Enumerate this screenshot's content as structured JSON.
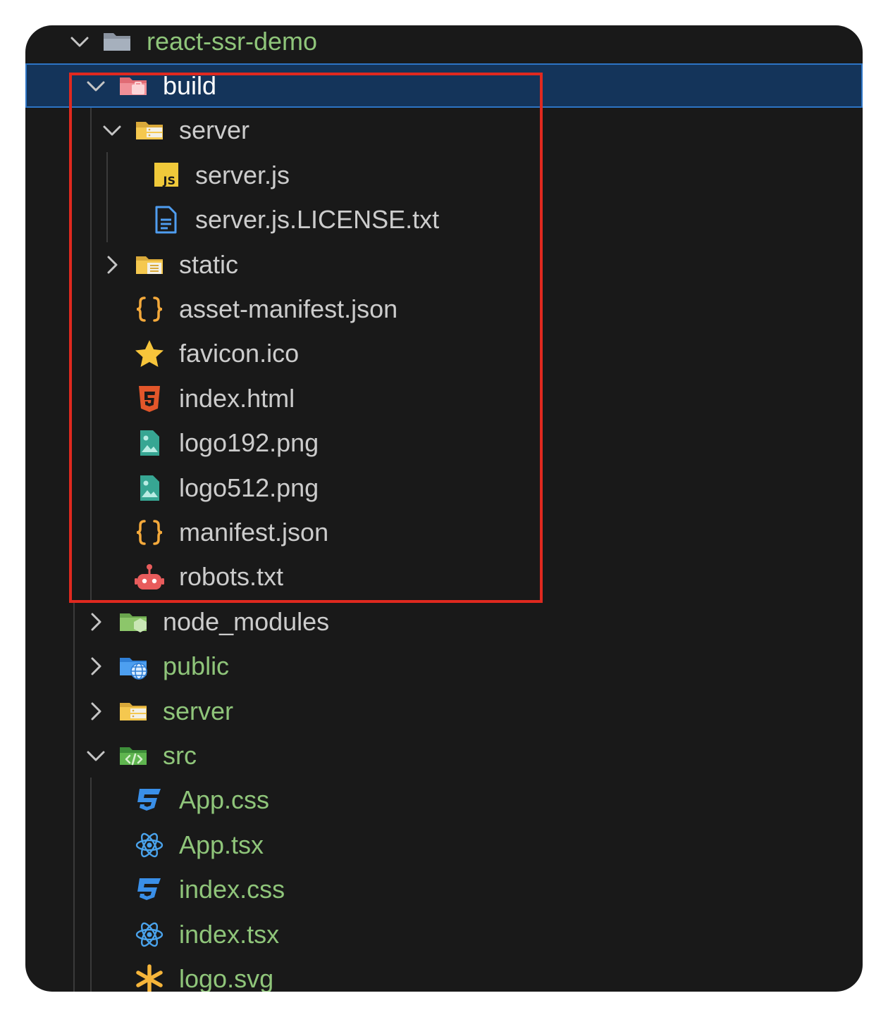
{
  "explorer": {
    "root": {
      "label": "react-ssr-demo",
      "icon": "folder-icon",
      "expanded": true
    },
    "items": [
      {
        "key": "build",
        "label": "build",
        "icon": "build-folder-icon",
        "depth": 1,
        "type": "folder",
        "expanded": true,
        "selected": true
      },
      {
        "key": "build-server",
        "label": "server",
        "icon": "server-folder-open-icon",
        "depth": 2,
        "type": "folder",
        "expanded": true
      },
      {
        "key": "server-js",
        "label": "server.js",
        "icon": "javascript-file-icon",
        "depth": 3,
        "type": "file"
      },
      {
        "key": "server-license",
        "label": "server.js.LICENSE.txt",
        "icon": "text-document-icon",
        "depth": 3,
        "type": "file"
      },
      {
        "key": "static",
        "label": "static",
        "icon": "static-folder-icon",
        "depth": 2,
        "type": "folder",
        "expanded": false
      },
      {
        "key": "asset-manifest",
        "label": "asset-manifest.json",
        "icon": "json-braces-icon",
        "depth": 2,
        "type": "file"
      },
      {
        "key": "favicon",
        "label": "favicon.ico",
        "icon": "star-icon",
        "depth": 2,
        "type": "file"
      },
      {
        "key": "index-html",
        "label": "index.html",
        "icon": "html5-icon",
        "depth": 2,
        "type": "file"
      },
      {
        "key": "logo192",
        "label": "logo192.png",
        "icon": "image-file-icon",
        "depth": 2,
        "type": "file"
      },
      {
        "key": "logo512",
        "label": "logo512.png",
        "icon": "image-file-icon",
        "depth": 2,
        "type": "file"
      },
      {
        "key": "manifest-json",
        "label": "manifest.json",
        "icon": "json-braces-icon",
        "depth": 2,
        "type": "file"
      },
      {
        "key": "robots",
        "label": "robots.txt",
        "icon": "robot-icon",
        "depth": 2,
        "type": "file"
      },
      {
        "key": "node-modules",
        "label": "node_modules",
        "icon": "node-folder-icon",
        "depth": 1,
        "type": "folder",
        "expanded": false
      },
      {
        "key": "public",
        "label": "public",
        "icon": "globe-folder-icon",
        "depth": 1,
        "type": "folder",
        "expanded": false
      },
      {
        "key": "server-root",
        "label": "server",
        "icon": "server-folder-icon",
        "depth": 1,
        "type": "folder",
        "expanded": false
      },
      {
        "key": "src",
        "label": "src",
        "icon": "code-folder-icon",
        "depth": 1,
        "type": "folder",
        "expanded": true
      },
      {
        "key": "app-css",
        "label": "App.css",
        "icon": "css3-icon",
        "depth": 2,
        "type": "file"
      },
      {
        "key": "app-tsx",
        "label": "App.tsx",
        "icon": "react-icon",
        "depth": 2,
        "type": "file"
      },
      {
        "key": "index-css",
        "label": "index.css",
        "icon": "css3-icon",
        "depth": 2,
        "type": "file"
      },
      {
        "key": "index-tsx",
        "label": "index.tsx",
        "icon": "react-icon",
        "depth": 2,
        "type": "file"
      },
      {
        "key": "logo-svg",
        "label": "logo.svg",
        "icon": "svg-asterisk-icon",
        "depth": 2,
        "type": "file"
      }
    ]
  },
  "colors": {
    "panel_bg": "#191919",
    "selected_bg": "#14345a",
    "selected_border": "#2d74c4",
    "label_default": "#cccccc",
    "label_git_untracked": "#8fc57a",
    "label_selected": "#ffffff",
    "annotation_box": "#e0291f"
  }
}
